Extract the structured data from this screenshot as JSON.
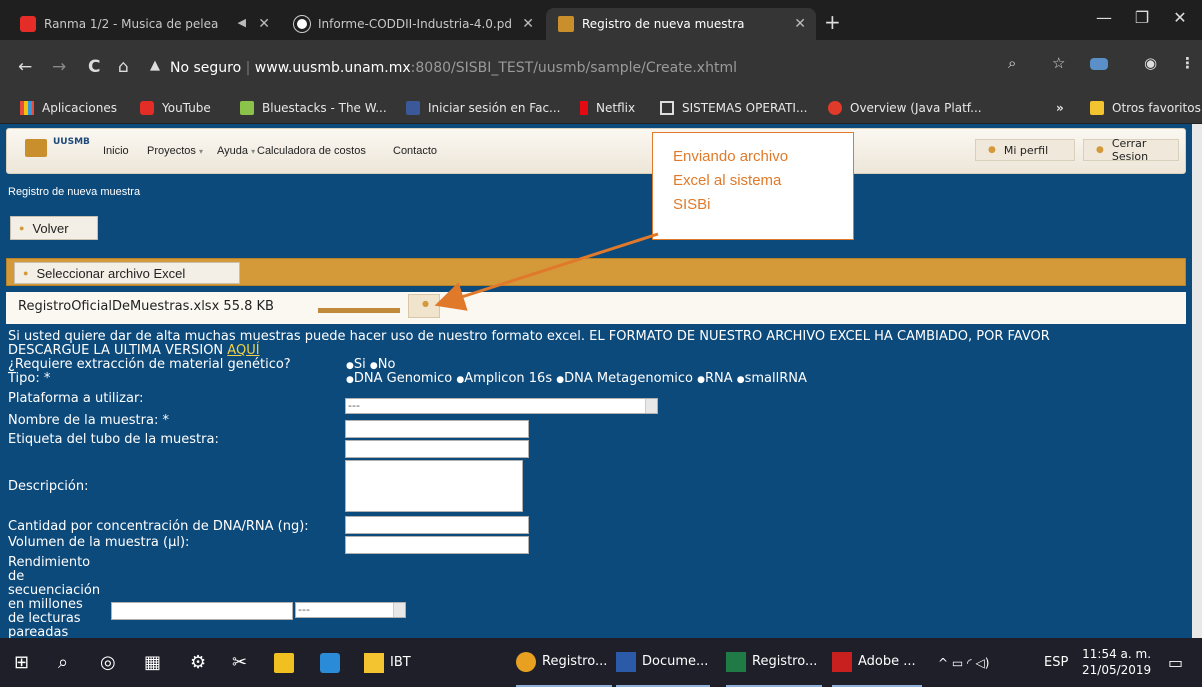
{
  "browser": {
    "tabs": [
      {
        "title": "Ranma 1/2 - Musica de pelea",
        "audio_icon": "◀",
        "active": false
      },
      {
        "title": "Informe-CODDII-Industria-4.0.pd",
        "active": false
      },
      {
        "title": "Registro de nueva muestra",
        "active": true
      }
    ],
    "new_tab": "+",
    "url_security": "No seguro",
    "url_host": "www.uusmb.unam.mx",
    "url_path": ":8080/SISBI_TEST/uusmb/sample/Create.xhtml",
    "bookmarks": [
      {
        "label": "Aplicaciones"
      },
      {
        "label": "YouTube"
      },
      {
        "label": "Bluestacks - The W..."
      },
      {
        "label": "Iniciar sesión en Fac..."
      },
      {
        "label": "Netflix"
      },
      {
        "label": "SISTEMAS OPERATI..."
      },
      {
        "label": "Overview (Java Platf..."
      }
    ],
    "more_bookmarks": "»",
    "other_favorites": "Otros favoritos"
  },
  "site": {
    "logo_text_1": "UUSMB",
    "nav": [
      "Inicio",
      "Proyectos",
      "Ayuda",
      "Calculadora de costos",
      "Contacto"
    ],
    "my_profile": "Mi perfil",
    "logout": "Cerrar Sesion",
    "page_title": "Registro de nueva muestra",
    "back_button": "Volver",
    "choose_file": "Seleccionar archivo Excel",
    "file_name": "RegistroOficialDeMuestras.xlsx",
    "file_size": "55.8 KB",
    "upload_progress": 1.0,
    "info_line_1": "Si usted quiere dar de alta muchas muestras puede hacer uso de nuestro formato excel. EL FORMATO DE NUESTRO ARCHIVO EXCEL HA CAMBIADO, POR FAVOR",
    "info_line_2": "DESCARGUE LA ULTIMA VERSION",
    "info_link": "AQUÍ",
    "q_extraction": "¿Requiere extracción de material genético?",
    "opt_si": "Si",
    "opt_no": "No",
    "q_tipo": "Tipo: *",
    "tipo_options": [
      "DNA Genomico",
      "Amplicon 16s",
      "DNA Metagenomico",
      "RNA",
      "smallRNA"
    ],
    "q_plataforma": "Plataforma a utilizar:",
    "plataforma_value": "---",
    "q_nombre": "Nombre de la muestra: *",
    "q_etiqueta": "Etiqueta del tubo de la muestra:",
    "q_descripcion": "Descripción:",
    "q_cantidad": "Cantidad por concentración de DNA/RNA (ng):",
    "q_volumen": "Volumen de la muestra (µl):",
    "q_rendimiento": [
      "Rendimiento",
      "de",
      "secuenciación",
      "en millones",
      "de lecturas",
      "pareadas"
    ],
    "rendimiento_select": "---"
  },
  "annotation": {
    "lines": [
      "Enviando archivo",
      "Excel al sistema",
      "SISBi"
    ],
    "color": "#e07a2a"
  },
  "taskbar": {
    "pinned_label": "IBT",
    "apps": [
      "Registro...",
      "Docume...",
      "Registro...",
      "Adobe ..."
    ],
    "language": "ESP",
    "time": "11:54 a. m.",
    "date": "21/05/2019"
  }
}
